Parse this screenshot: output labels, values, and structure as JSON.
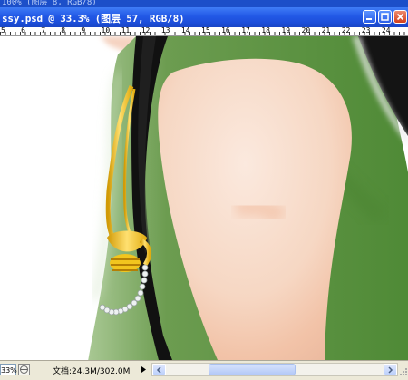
{
  "window": {
    "behind_title": "100% (图层 8, RGB/8)",
    "title": "ssy.psd @ 33.3% (图层 57, RGB/8)",
    "controls": [
      "minimize-icon",
      "restore-icon",
      "close-icon"
    ]
  },
  "ruler": {
    "labels": [
      "5",
      "6",
      "7",
      "8",
      "9",
      "10",
      "11",
      "12",
      "13",
      "14",
      "15",
      "16",
      "17",
      "18",
      "19",
      "20",
      "21",
      "22",
      "23",
      "24"
    ]
  },
  "status": {
    "zoom": "33%",
    "document_info": "文档:24.3M/302.0M"
  },
  "colors": {
    "title_bar": "#2258e6",
    "canvas_green": "#5c9440",
    "skin": "#f7d5c0",
    "gold": "#f2c51e",
    "hair": "#111111"
  }
}
